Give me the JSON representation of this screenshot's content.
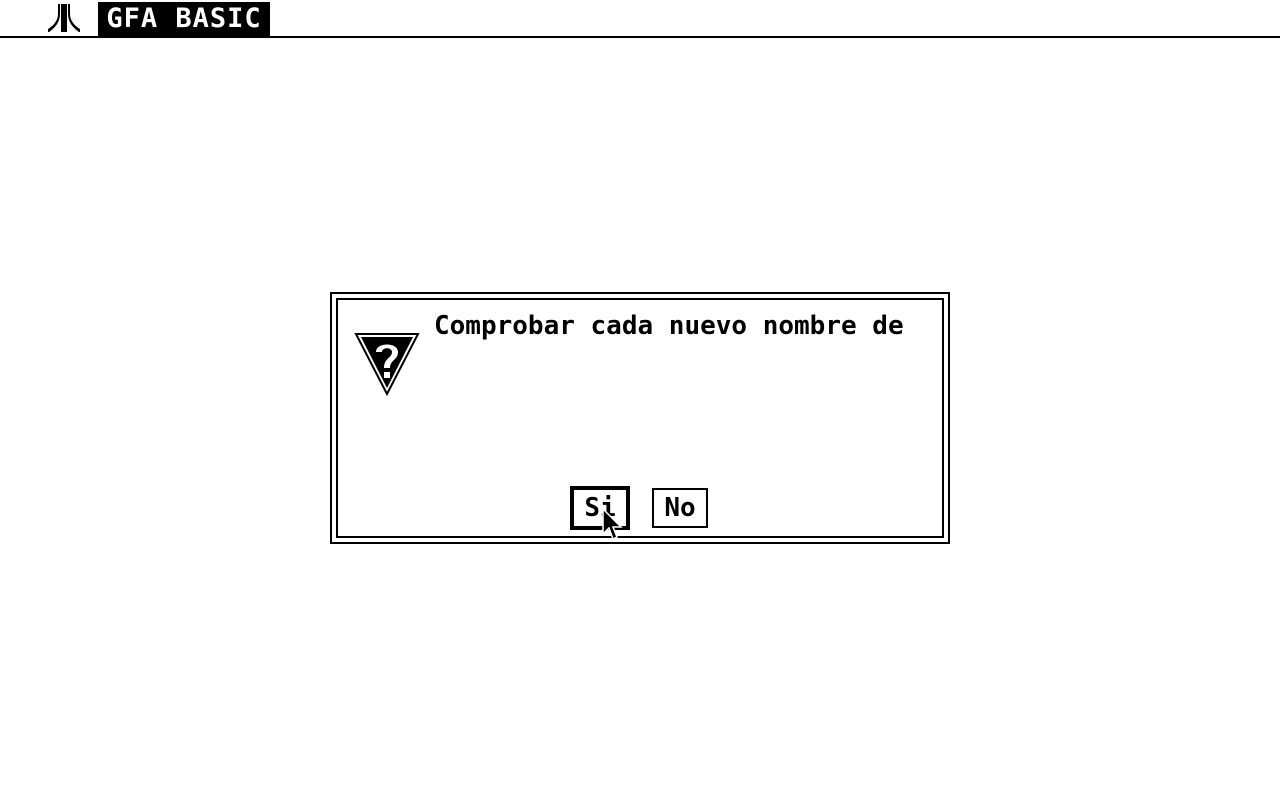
{
  "menubar": {
    "logo_icon": "atari-fuji-icon",
    "app_title": "GFA BASIC"
  },
  "alert": {
    "icon": "question-mark-icon",
    "message_lines": [
      "Comprobar cada nuevo nombre de"
    ],
    "buttons": [
      {
        "label": "Si",
        "default": true
      },
      {
        "label": "No",
        "default": false
      }
    ]
  },
  "cursor": {
    "icon": "mouse-pointer-icon"
  }
}
